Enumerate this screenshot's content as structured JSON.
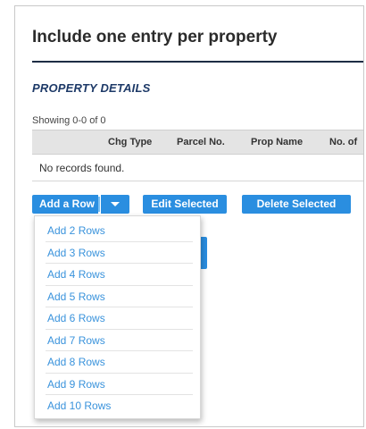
{
  "page": {
    "heading": "Include one entry per property",
    "section_title": "PROPERTY DETAILS"
  },
  "grid": {
    "showing_text": "Showing 0-0 of 0",
    "columns": [
      "Chg Type",
      "Parcel No.",
      "Prop Name",
      "No. of"
    ],
    "empty_text": "No records found."
  },
  "toolbar": {
    "add_label": "Add a Row",
    "edit_label": "Edit Selected",
    "delete_label": "Delete Selected"
  },
  "menu": {
    "items": [
      "Add 2 Rows",
      "Add 3 Rows",
      "Add 4 Rows",
      "Add 5 Rows",
      "Add 6 Rows",
      "Add 7 Rows",
      "Add 8 Rows",
      "Add 9 Rows",
      "Add 10 Rows"
    ]
  },
  "colors": {
    "accent": "#2a8ee0",
    "link": "#3a93dc",
    "section_title": "#1e3a68"
  }
}
